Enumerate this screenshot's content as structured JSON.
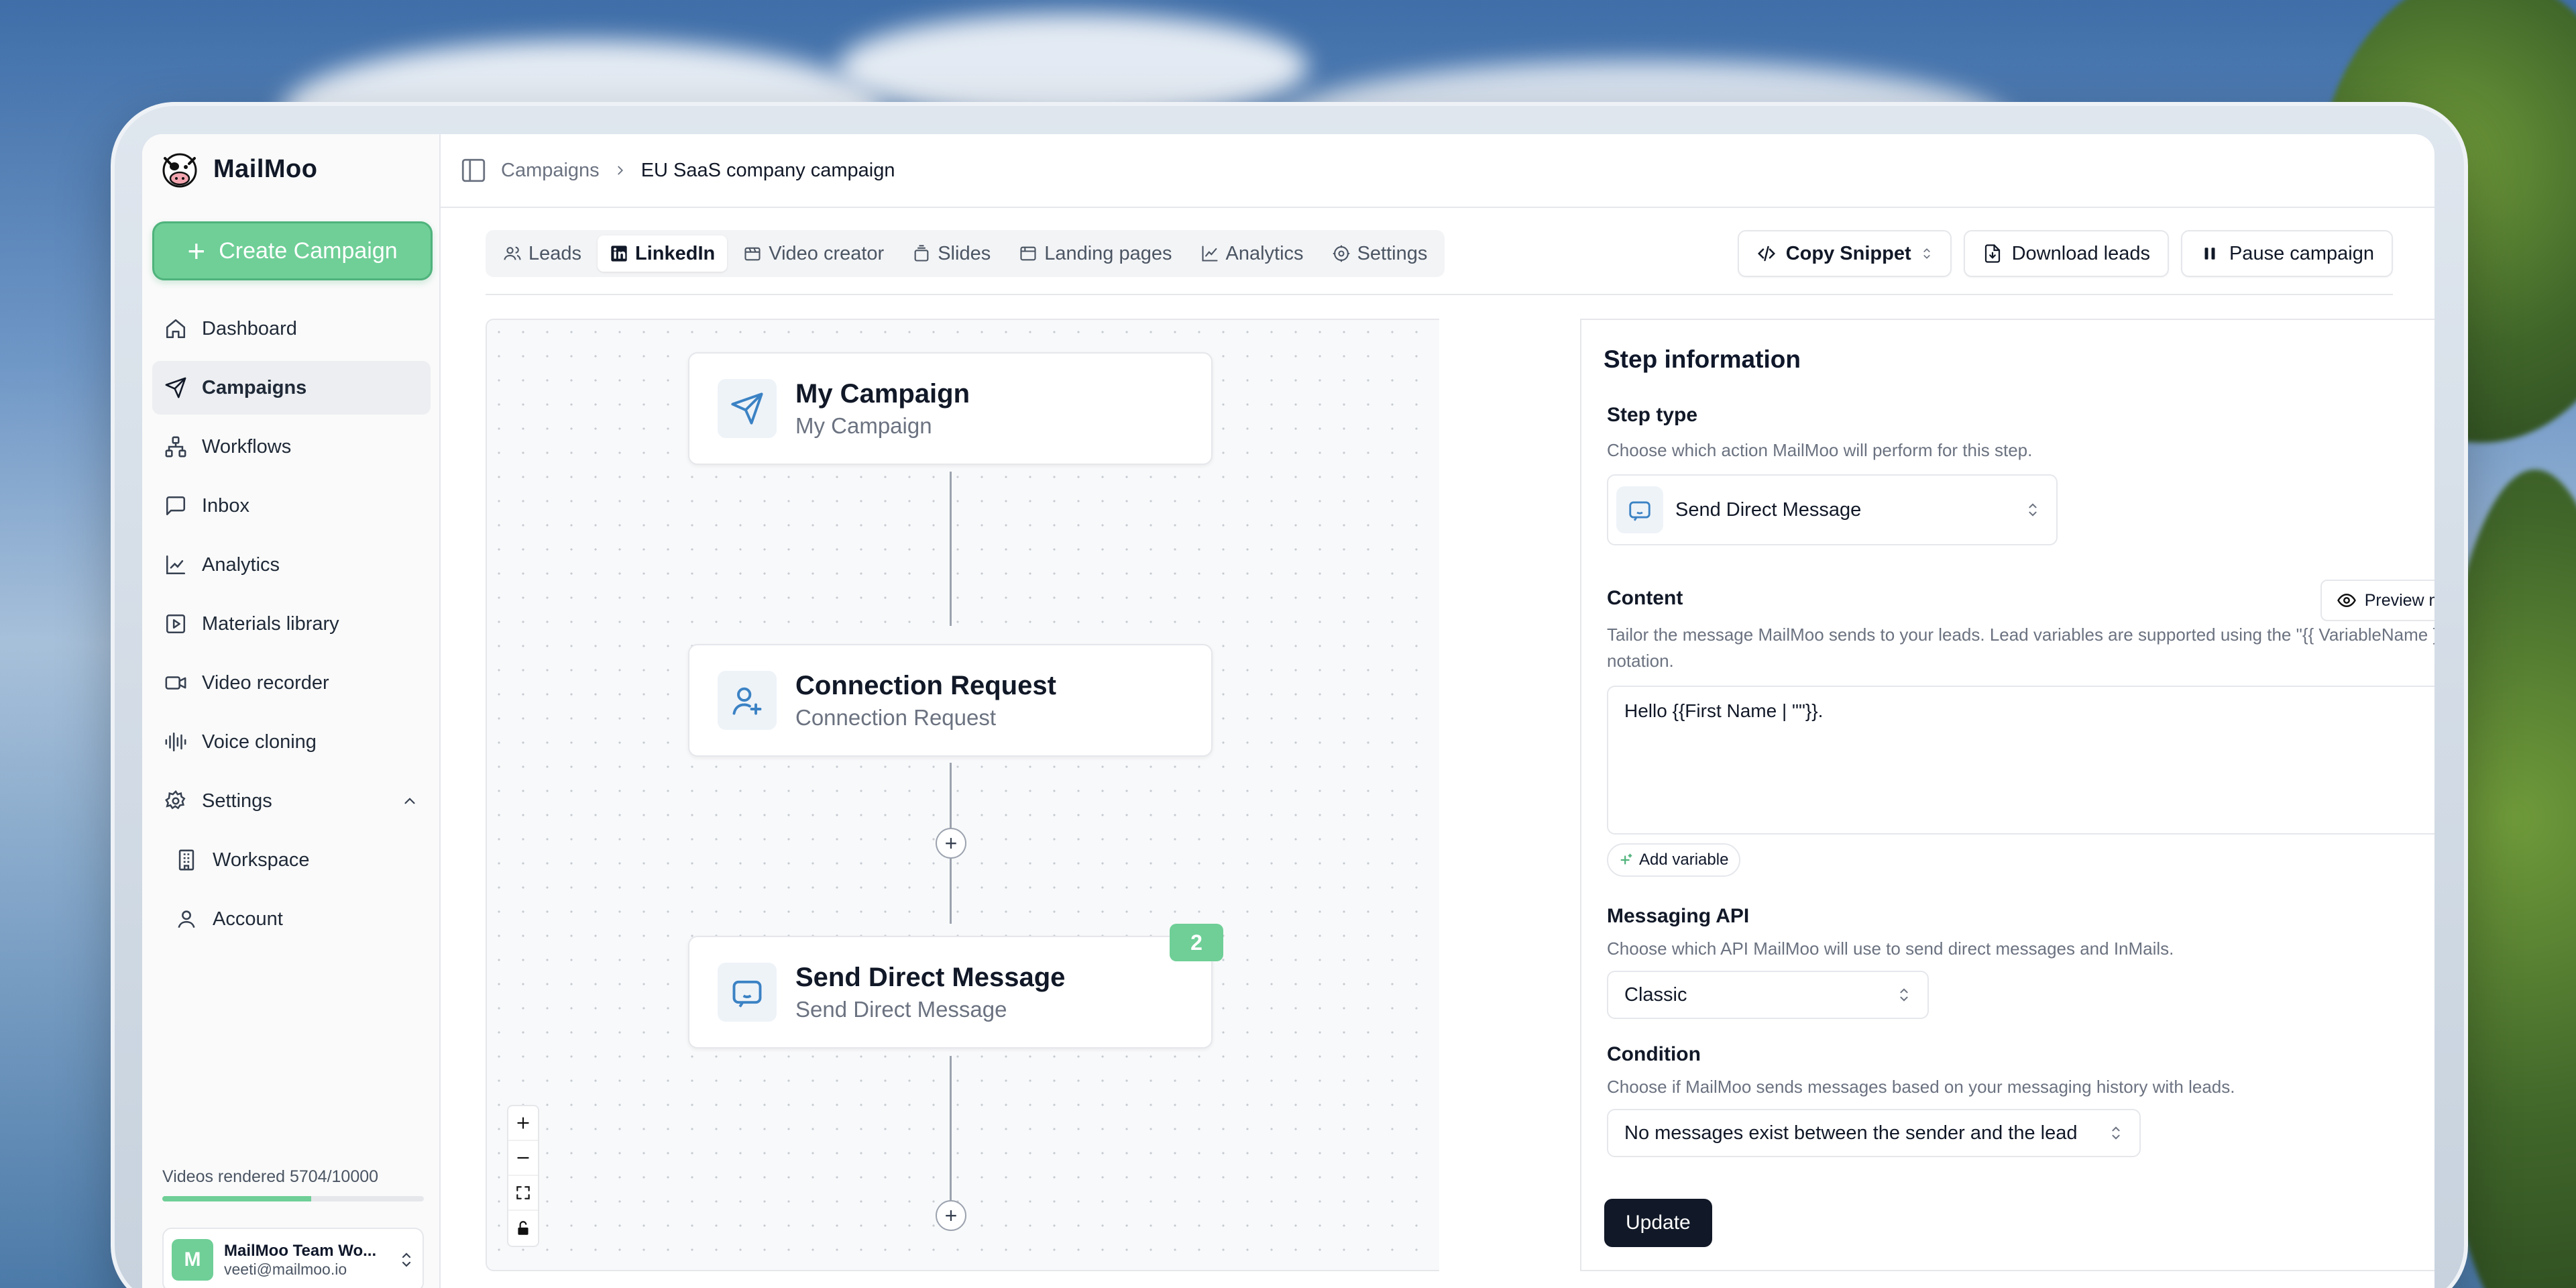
{
  "app": {
    "name": "MailMoo"
  },
  "sidebar": {
    "create_label": "Create Campaign",
    "items": [
      {
        "label": "Dashboard",
        "icon": "home-icon"
      },
      {
        "label": "Campaigns",
        "icon": "send-icon",
        "active": true
      },
      {
        "label": "Workflows",
        "icon": "workflow-icon"
      },
      {
        "label": "Inbox",
        "icon": "message-icon"
      },
      {
        "label": "Analytics",
        "icon": "chart-icon"
      },
      {
        "label": "Materials library",
        "icon": "play-square-icon"
      },
      {
        "label": "Video recorder",
        "icon": "video-icon"
      },
      {
        "label": "Voice cloning",
        "icon": "audio-wave-icon"
      },
      {
        "label": "Settings",
        "icon": "gear-icon",
        "expanded": true
      }
    ],
    "sub_items": [
      {
        "label": "Workspace",
        "icon": "building-icon"
      },
      {
        "label": "Account",
        "icon": "user-icon"
      }
    ],
    "usage": {
      "label": "Videos rendered 5704/10000",
      "used": 5704,
      "total": 10000
    },
    "account": {
      "initial": "M",
      "name": "MailMoo Team Wo...",
      "email": "veeti@mailmoo.io"
    }
  },
  "breadcrumb": {
    "parent": "Campaigns",
    "current": "EU SaaS company campaign"
  },
  "tabs": [
    {
      "label": "Leads",
      "icon": "users-icon"
    },
    {
      "label": "LinkedIn",
      "icon": "linkedin-icon",
      "active": true
    },
    {
      "label": "Video creator",
      "icon": "video-creator-icon"
    },
    {
      "label": "Slides",
      "icon": "slides-icon"
    },
    {
      "label": "Landing pages",
      "icon": "browser-icon"
    },
    {
      "label": "Analytics",
      "icon": "line-chart-icon"
    },
    {
      "label": "Settings",
      "icon": "gear-icon"
    }
  ],
  "actions": {
    "copy_snippet": "Copy Snippet",
    "download_leads": "Download leads",
    "pause_campaign": "Pause campaign"
  },
  "flow": {
    "nodes": [
      {
        "title": "My Campaign",
        "subtitle": "My Campaign",
        "icon": "send-icon"
      },
      {
        "title": "Connection Request",
        "subtitle": "Connection Request",
        "icon": "user-plus-icon"
      },
      {
        "title": "Send Direct Message",
        "subtitle": "Send Direct Message",
        "icon": "message-bot-icon",
        "badge": "2"
      }
    ],
    "add_symbol": "+"
  },
  "step": {
    "title": "Step information",
    "step_type": {
      "label": "Step type",
      "help": "Choose which action MailMoo will perform for this step.",
      "value": "Send Direct Message"
    },
    "content": {
      "label": "Content",
      "help": "Tailor the message MailMoo sends to your leads. Lead variables are supported using the \"{{ VariableName }}\" notation.",
      "value": "Hello {{First Name | \"\"}}.",
      "preview_label": "Preview message",
      "add_variable_label": "Add variable"
    },
    "messaging_api": {
      "label": "Messaging API",
      "help": "Choose which API MailMoo will use to send direct messages and InMails.",
      "value": "Classic"
    },
    "condition": {
      "label": "Condition",
      "help": "Choose if MailMoo sends messages based on your messaging history with leads.",
      "value": "No messages exist between the sender and the lead"
    },
    "update_label": "Update"
  },
  "colors": {
    "accent": "#6fcf97",
    "dark": "#111827"
  }
}
